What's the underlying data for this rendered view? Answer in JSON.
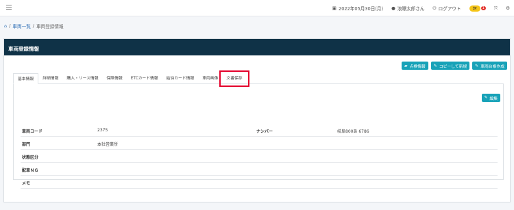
{
  "topbar": {
    "date": "2022年05月30日(月)",
    "user": "浪曝太郎さん",
    "logout": "ログアウト",
    "badge_label": "ﾖﾏ",
    "badge_count": "1"
  },
  "breadcrumb": {
    "home_icon": "home-icon",
    "items": [
      "車両一覧",
      "車両登録情報"
    ]
  },
  "panel": {
    "title": "車両登録情報",
    "actions": [
      {
        "label": "点検情報",
        "icon": "truck-icon"
      },
      {
        "label": "コピーして新規",
        "icon": "edit-icon"
      },
      {
        "label": "車両台帳作成",
        "icon": "edit-icon"
      }
    ],
    "tabs": [
      "基本情報",
      "詳細情報",
      "購入・リース情報",
      "保険情報",
      "ETCカード情報",
      "給油カード情報",
      "車両画像",
      "文書保存"
    ],
    "edit_label": "編集",
    "rows": [
      {
        "label": "車両コード",
        "value": "2375",
        "label2": "ナンバー",
        "value2": "岐阜800あ 6786"
      },
      {
        "label": "部門",
        "value": "本社営業所",
        "label2": "",
        "value2": ""
      },
      {
        "label": "状態区分",
        "value": "",
        "label2": "",
        "value2": ""
      },
      {
        "label": "配車ＮＧ",
        "value": "",
        "label2": "",
        "value2": ""
      },
      {
        "label": "メモ",
        "value": "",
        "label2": "",
        "value2": ""
      }
    ]
  },
  "colors": {
    "header_bg": "#0f3247",
    "button_bg": "#17a2b8",
    "highlight": "#e4002b"
  }
}
